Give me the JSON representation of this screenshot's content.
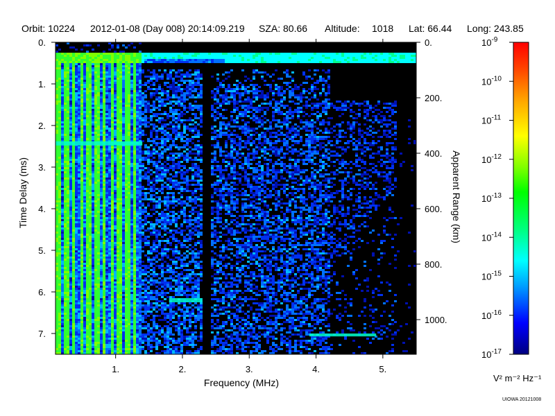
{
  "header": {
    "orbit": "Orbit: 10224",
    "datetime": "2012-01-08 (Day 008) 20:14:09.219",
    "sza": "SZA:  80.66",
    "altitude_label": "Altitude:",
    "altitude_value": "1018",
    "lat": "Lat:  66.44",
    "long": "Long: 243.85"
  },
  "chart_data": {
    "type": "heatmap",
    "xlabel": "Frequency (MHz)",
    "ylabel": "Time Delay (ms)",
    "ylabel_right": "Apparent Range (km)",
    "xlim": [
      0.1,
      5.5
    ],
    "ylim": [
      0,
      7.5
    ],
    "ylim_right": [
      0,
      1125
    ],
    "x_ticks": [
      {
        "value": 1,
        "label": "1."
      },
      {
        "value": 2,
        "label": "2."
      },
      {
        "value": 3,
        "label": "3."
      },
      {
        "value": 4,
        "label": "4."
      },
      {
        "value": 5,
        "label": "5."
      }
    ],
    "y_ticks": [
      {
        "value": 0,
        "label": "0."
      },
      {
        "value": 1,
        "label": "1."
      },
      {
        "value": 2,
        "label": "2."
      },
      {
        "value": 3,
        "label": "3."
      },
      {
        "value": 4,
        "label": "4."
      },
      {
        "value": 5,
        "label": "5."
      },
      {
        "value": 6,
        "label": "6."
      },
      {
        "value": 7,
        "label": "7."
      }
    ],
    "y_right_ticks": [
      {
        "value": 0,
        "label": "0."
      },
      {
        "value": 200,
        "label": "200."
      },
      {
        "value": 400,
        "label": "400."
      },
      {
        "value": 600,
        "label": "600."
      },
      {
        "value": 800,
        "label": "800."
      },
      {
        "value": 1000,
        "label": "1000."
      }
    ],
    "colorbar": {
      "scale": "log",
      "range": [
        1e-17,
        1e-09
      ],
      "ticks": [
        {
          "value": -9,
          "base": "10",
          "exp": "-9"
        },
        {
          "value": -10,
          "base": "10",
          "exp": "-10"
        },
        {
          "value": -11,
          "base": "10",
          "exp": "-11"
        },
        {
          "value": -12,
          "base": "10",
          "exp": "-12"
        },
        {
          "value": -13,
          "base": "10",
          "exp": "-13"
        },
        {
          "value": -14,
          "base": "10",
          "exp": "-14"
        },
        {
          "value": -15,
          "base": "10",
          "exp": "-15"
        },
        {
          "value": -16,
          "base": "10",
          "exp": "-16"
        },
        {
          "value": -17,
          "base": "10",
          "exp": "-17"
        }
      ],
      "unit": "V² m⁻² Hz⁻¹",
      "colors": [
        "#00007f",
        "#0000ff",
        "#00a0ff",
        "#00ffff",
        "#00ff80",
        "#00ff00",
        "#80ff00",
        "#ffff00",
        "#ffa000",
        "#ff4000",
        "#ff0000"
      ]
    },
    "background_color": "#000000",
    "features": [
      {
        "name": "strong green noise at low frequency",
        "x_range": [
          0.1,
          1.35
        ],
        "y_range": [
          0.25,
          7.5
        ]
      },
      {
        "name": "surface-level band",
        "x_range": [
          0.1,
          5.5
        ],
        "y_range": [
          0.25,
          0.45
        ]
      },
      {
        "name": "blue diffuse echoes",
        "x_range": [
          1.35,
          5.2
        ],
        "y_range": [
          0.6,
          7.5
        ]
      }
    ]
  },
  "credit": "UIOWA 20121008"
}
